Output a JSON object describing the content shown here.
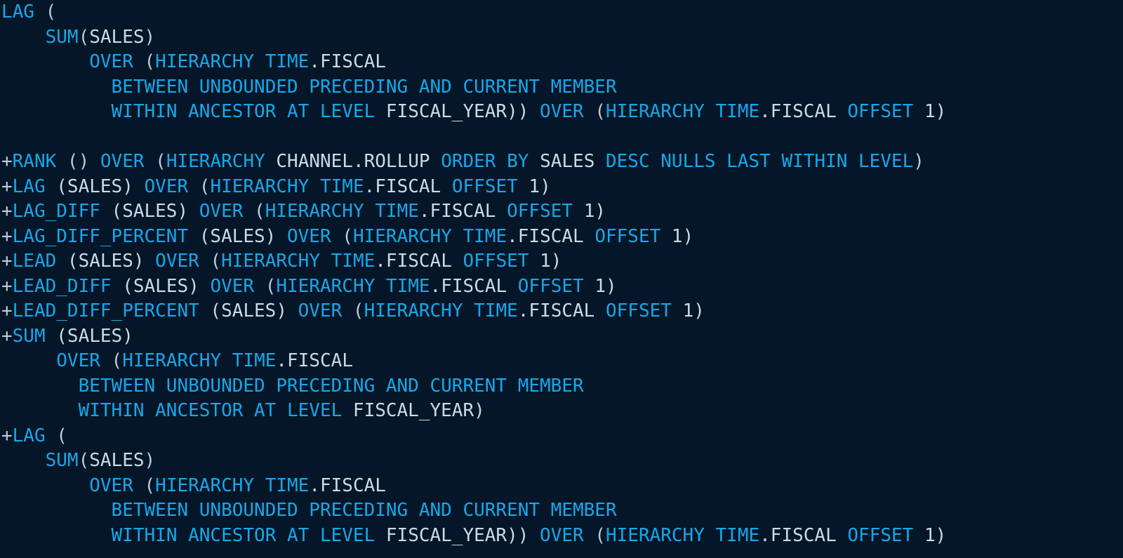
{
  "editor": {
    "name": "code-snippet-viewer",
    "language": "SQL",
    "background_color": "#041627",
    "keyword_color": "#17a7ea",
    "identifier_color": "#ccd9e8",
    "punctuation_color": "#b9cddd",
    "font_size_px": 26,
    "line_height_px": 35.5
  },
  "lines": [
    {
      "index": 0,
      "tokens": [
        {
          "t": "LAG",
          "c": "kw"
        },
        {
          "t": " (",
          "c": "pun"
        }
      ]
    },
    {
      "index": 1,
      "tokens": [
        {
          "t": "    ",
          "c": "pun"
        },
        {
          "t": "SUM",
          "c": "kw"
        },
        {
          "t": "(",
          "c": "pun"
        },
        {
          "t": "SALES",
          "c": "id"
        },
        {
          "t": ")",
          "c": "pun"
        }
      ]
    },
    {
      "index": 2,
      "tokens": [
        {
          "t": "        ",
          "c": "pun"
        },
        {
          "t": "OVER",
          "c": "kw"
        },
        {
          "t": " (",
          "c": "pun"
        },
        {
          "t": "HIERARCHY",
          "c": "kw"
        },
        {
          "t": " ",
          "c": "pun"
        },
        {
          "t": "TIME",
          "c": "kw"
        },
        {
          "t": ".FISCAL",
          "c": "id"
        }
      ]
    },
    {
      "index": 3,
      "tokens": [
        {
          "t": "          ",
          "c": "pun"
        },
        {
          "t": "BETWEEN UNBOUNDED PRECEDING AND CURRENT MEMBER",
          "c": "kw"
        }
      ]
    },
    {
      "index": 4,
      "tokens": [
        {
          "t": "          ",
          "c": "pun"
        },
        {
          "t": "WITHIN ANCESTOR AT LEVEL",
          "c": "kw"
        },
        {
          "t": " FISCAL_YEAR))",
          "c": "id"
        },
        {
          "t": " ",
          "c": "pun"
        },
        {
          "t": "OVER",
          "c": "kw"
        },
        {
          "t": " (",
          "c": "pun"
        },
        {
          "t": "HIERARCHY",
          "c": "kw"
        },
        {
          "t": " ",
          "c": "pun"
        },
        {
          "t": "TIME",
          "c": "kw"
        },
        {
          "t": ".FISCAL",
          "c": "id"
        },
        {
          "t": " ",
          "c": "pun"
        },
        {
          "t": "OFFSET",
          "c": "kw"
        },
        {
          "t": " 1)",
          "c": "num"
        }
      ]
    },
    {
      "index": 5,
      "tokens": []
    },
    {
      "index": 6,
      "tokens": [
        {
          "t": "+",
          "c": "plus"
        },
        {
          "t": "RANK",
          "c": "kw"
        },
        {
          "t": " () ",
          "c": "pun"
        },
        {
          "t": "OVER",
          "c": "kw"
        },
        {
          "t": " (",
          "c": "pun"
        },
        {
          "t": "HIERARCHY",
          "c": "kw"
        },
        {
          "t": " CHANNEL.ROLLUP ",
          "c": "id"
        },
        {
          "t": "ORDER BY",
          "c": "kw"
        },
        {
          "t": " SALES ",
          "c": "id"
        },
        {
          "t": "DESC NULLS LAST WITHIN LEVEL",
          "c": "kw"
        },
        {
          "t": ")",
          "c": "pun"
        }
      ]
    },
    {
      "index": 7,
      "tokens": [
        {
          "t": "+",
          "c": "plus"
        },
        {
          "t": "LAG",
          "c": "kw"
        },
        {
          "t": " (SALES) ",
          "c": "id"
        },
        {
          "t": "OVER",
          "c": "kw"
        },
        {
          "t": " (",
          "c": "pun"
        },
        {
          "t": "HIERARCHY",
          "c": "kw"
        },
        {
          "t": " ",
          "c": "pun"
        },
        {
          "t": "TIME",
          "c": "kw"
        },
        {
          "t": ".FISCAL",
          "c": "id"
        },
        {
          "t": " ",
          "c": "pun"
        },
        {
          "t": "OFFSET",
          "c": "kw"
        },
        {
          "t": " 1)",
          "c": "num"
        }
      ]
    },
    {
      "index": 8,
      "tokens": [
        {
          "t": "+",
          "c": "plus"
        },
        {
          "t": "LAG_DIFF",
          "c": "kw"
        },
        {
          "t": " (SALES) ",
          "c": "id"
        },
        {
          "t": "OVER",
          "c": "kw"
        },
        {
          "t": " (",
          "c": "pun"
        },
        {
          "t": "HIERARCHY",
          "c": "kw"
        },
        {
          "t": " ",
          "c": "pun"
        },
        {
          "t": "TIME",
          "c": "kw"
        },
        {
          "t": ".FISCAL",
          "c": "id"
        },
        {
          "t": " ",
          "c": "pun"
        },
        {
          "t": "OFFSET",
          "c": "kw"
        },
        {
          "t": " 1)",
          "c": "num"
        }
      ]
    },
    {
      "index": 9,
      "tokens": [
        {
          "t": "+",
          "c": "plus"
        },
        {
          "t": "LAG_DIFF_PERCENT",
          "c": "kw"
        },
        {
          "t": " (SALES) ",
          "c": "id"
        },
        {
          "t": "OVER",
          "c": "kw"
        },
        {
          "t": " (",
          "c": "pun"
        },
        {
          "t": "HIERARCHY",
          "c": "kw"
        },
        {
          "t": " ",
          "c": "pun"
        },
        {
          "t": "TIME",
          "c": "kw"
        },
        {
          "t": ".FISCAL",
          "c": "id"
        },
        {
          "t": " ",
          "c": "pun"
        },
        {
          "t": "OFFSET",
          "c": "kw"
        },
        {
          "t": " 1)",
          "c": "num"
        }
      ]
    },
    {
      "index": 10,
      "tokens": [
        {
          "t": "+",
          "c": "plus"
        },
        {
          "t": "LEAD",
          "c": "kw"
        },
        {
          "t": " (SALES) ",
          "c": "id"
        },
        {
          "t": "OVER",
          "c": "kw"
        },
        {
          "t": " (",
          "c": "pun"
        },
        {
          "t": "HIERARCHY",
          "c": "kw"
        },
        {
          "t": " ",
          "c": "pun"
        },
        {
          "t": "TIME",
          "c": "kw"
        },
        {
          "t": ".FISCAL",
          "c": "id"
        },
        {
          "t": " ",
          "c": "pun"
        },
        {
          "t": "OFFSET",
          "c": "kw"
        },
        {
          "t": " 1)",
          "c": "num"
        }
      ]
    },
    {
      "index": 11,
      "tokens": [
        {
          "t": "+",
          "c": "plus"
        },
        {
          "t": "LEAD_DIFF",
          "c": "kw"
        },
        {
          "t": " (SALES) ",
          "c": "id"
        },
        {
          "t": "OVER",
          "c": "kw"
        },
        {
          "t": " (",
          "c": "pun"
        },
        {
          "t": "HIERARCHY",
          "c": "kw"
        },
        {
          "t": " ",
          "c": "pun"
        },
        {
          "t": "TIME",
          "c": "kw"
        },
        {
          "t": ".FISCAL",
          "c": "id"
        },
        {
          "t": " ",
          "c": "pun"
        },
        {
          "t": "OFFSET",
          "c": "kw"
        },
        {
          "t": " 1)",
          "c": "num"
        }
      ]
    },
    {
      "index": 12,
      "tokens": [
        {
          "t": "+",
          "c": "plus"
        },
        {
          "t": "LEAD_DIFF_PERCENT",
          "c": "kw"
        },
        {
          "t": " (SALES) ",
          "c": "id"
        },
        {
          "t": "OVER",
          "c": "kw"
        },
        {
          "t": " (",
          "c": "pun"
        },
        {
          "t": "HIERARCHY",
          "c": "kw"
        },
        {
          "t": " ",
          "c": "pun"
        },
        {
          "t": "TIME",
          "c": "kw"
        },
        {
          "t": ".FISCAL",
          "c": "id"
        },
        {
          "t": " ",
          "c": "pun"
        },
        {
          "t": "OFFSET",
          "c": "kw"
        },
        {
          "t": " 1)",
          "c": "num"
        }
      ]
    },
    {
      "index": 13,
      "tokens": [
        {
          "t": "+",
          "c": "plus"
        },
        {
          "t": "SUM",
          "c": "kw"
        },
        {
          "t": " (SALES)",
          "c": "id"
        }
      ]
    },
    {
      "index": 14,
      "tokens": [
        {
          "t": "     ",
          "c": "pun"
        },
        {
          "t": "OVER",
          "c": "kw"
        },
        {
          "t": " (",
          "c": "pun"
        },
        {
          "t": "HIERARCHY",
          "c": "kw"
        },
        {
          "t": " ",
          "c": "pun"
        },
        {
          "t": "TIME",
          "c": "kw"
        },
        {
          "t": ".FISCAL",
          "c": "id"
        }
      ]
    },
    {
      "index": 15,
      "tokens": [
        {
          "t": "       ",
          "c": "pun"
        },
        {
          "t": "BETWEEN UNBOUNDED PRECEDING AND CURRENT MEMBER",
          "c": "kw"
        }
      ]
    },
    {
      "index": 16,
      "tokens": [
        {
          "t": "       ",
          "c": "pun"
        },
        {
          "t": "WITHIN ANCESTOR AT LEVEL",
          "c": "kw"
        },
        {
          "t": " FISCAL_YEAR)",
          "c": "id"
        }
      ]
    },
    {
      "index": 17,
      "tokens": [
        {
          "t": "+",
          "c": "plus"
        },
        {
          "t": "LAG",
          "c": "kw"
        },
        {
          "t": " (",
          "c": "pun"
        }
      ]
    },
    {
      "index": 18,
      "tokens": [
        {
          "t": "    ",
          "c": "pun"
        },
        {
          "t": "SUM",
          "c": "kw"
        },
        {
          "t": "(",
          "c": "pun"
        },
        {
          "t": "SALES",
          "c": "id"
        },
        {
          "t": ")",
          "c": "pun"
        }
      ]
    },
    {
      "index": 19,
      "tokens": [
        {
          "t": "        ",
          "c": "pun"
        },
        {
          "t": "OVER",
          "c": "kw"
        },
        {
          "t": " (",
          "c": "pun"
        },
        {
          "t": "HIERARCHY",
          "c": "kw"
        },
        {
          "t": " ",
          "c": "pun"
        },
        {
          "t": "TIME",
          "c": "kw"
        },
        {
          "t": ".FISCAL",
          "c": "id"
        }
      ]
    },
    {
      "index": 20,
      "tokens": [
        {
          "t": "          ",
          "c": "pun"
        },
        {
          "t": "BETWEEN UNBOUNDED PRECEDING AND CURRENT MEMBER",
          "c": "kw"
        }
      ]
    },
    {
      "index": 21,
      "tokens": [
        {
          "t": "          ",
          "c": "pun"
        },
        {
          "t": "WITHIN ANCESTOR AT LEVEL",
          "c": "kw"
        },
        {
          "t": " FISCAL_YEAR))",
          "c": "id"
        },
        {
          "t": " ",
          "c": "pun"
        },
        {
          "t": "OVER",
          "c": "kw"
        },
        {
          "t": " (",
          "c": "pun"
        },
        {
          "t": "HIERARCHY",
          "c": "kw"
        },
        {
          "t": " ",
          "c": "pun"
        },
        {
          "t": "TIME",
          "c": "kw"
        },
        {
          "t": ".FISCAL",
          "c": "id"
        },
        {
          "t": " ",
          "c": "pun"
        },
        {
          "t": "OFFSET",
          "c": "kw"
        },
        {
          "t": " 1)",
          "c": "num"
        }
      ]
    }
  ]
}
